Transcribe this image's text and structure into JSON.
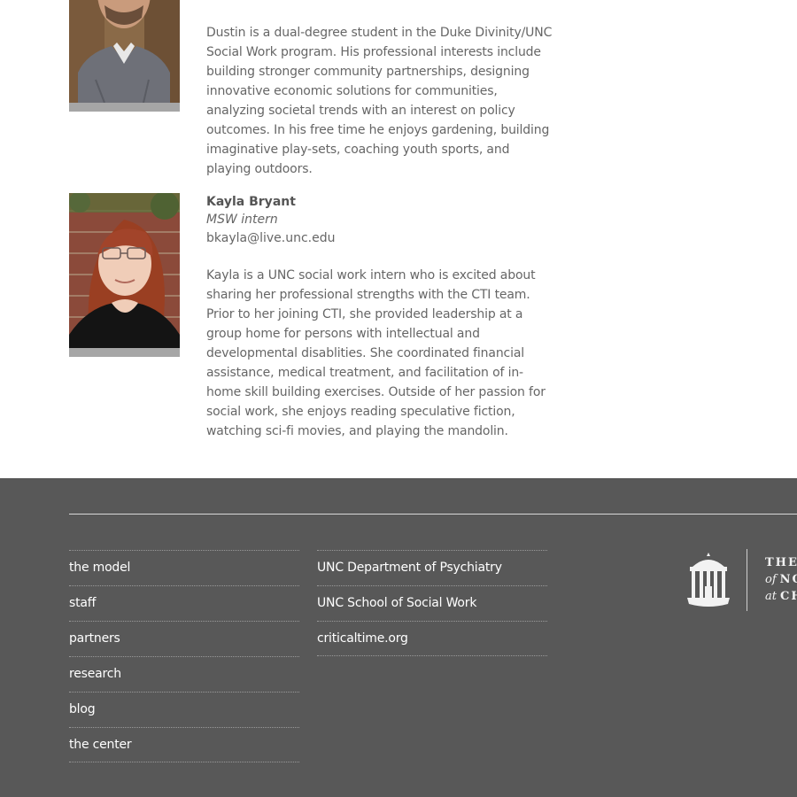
{
  "staff": [
    {
      "name": "",
      "role": "",
      "email": "",
      "bio": "Dustin is a dual-degree student in the Duke Divinity/UNC Social Work program. His professional interests include building stronger community partnerships, designing innovative economic solutions for communities, analyzing societal trends with an interest on policy outcomes. In his free time he enjoys gardening, building imaginative play-sets, coaching youth sports, and playing outdoors."
    },
    {
      "name": "Kayla Bryant",
      "role": "MSW intern",
      "email": "bkayla@live.unc.edu",
      "bio": "Kayla is a UNC social work intern who is excited about sharing her professional strengths with the CTI team. Prior to her joining CTI, she provided leadership at a group home for persons with intellectual and developmental disablities. She coordinated financial assistance, medical treatment, and facilitation of in-home skill building exercises. Outside of her passion for social work, she enjoys reading speculative fiction, watching sci-fi movies, and playing the mandolin."
    }
  ],
  "footer": {
    "nav_left": [
      "the model",
      "staff",
      "partners",
      "research",
      "blog",
      "the center"
    ],
    "nav_right": [
      "UNC Department of Psychiatry",
      "UNC School of Social Work",
      "criticaltime.org"
    ],
    "logo": {
      "line1": "THE",
      "line2_italic": "of",
      "line2": "NO",
      "line3_italic": "at",
      "line3": "CH"
    }
  },
  "colors": {
    "footer_bg": "#585858",
    "body_text": "#666666",
    "photo_frame": "#a6a6a6"
  }
}
